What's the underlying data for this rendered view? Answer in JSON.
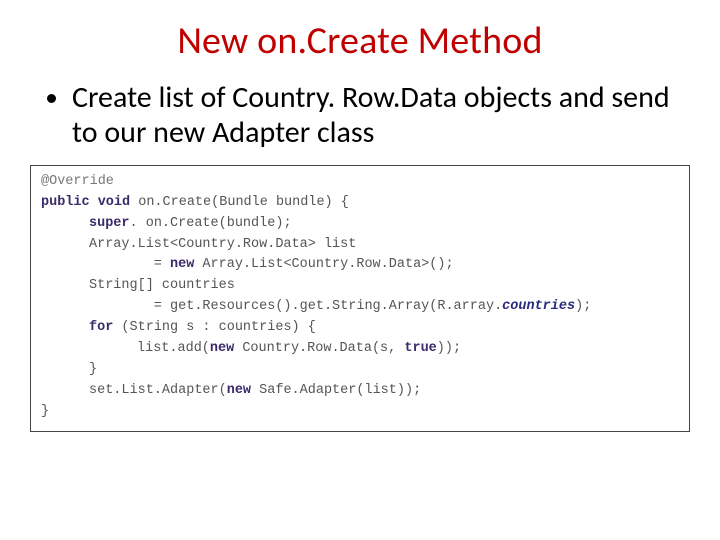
{
  "slide": {
    "title": "New on.Create Method",
    "bullets": [
      "Create list of Country. Row.Data objects and send to our new Adapter class"
    ]
  },
  "code": {
    "l01_ann": "@Override",
    "l02_kw1": "public void",
    "l02_rest": " on.Create(Bundle bundle) {",
    "l03_kw": "super",
    "l03_rest": ". on.Create(bundle);",
    "l04": "Array.List<Country.Row.Data> list",
    "l05_kw": "new",
    "l05_rest": " Array.List<Country.Row.Data>();",
    "l05_pre": "        = ",
    "l06": "String[] countries",
    "l07_pre": "        = get.Resources().get.String.Array(R.array.",
    "l07_em": "countries",
    "l07_post": ");",
    "l08_kw": "for",
    "l08_rest": " (String s : countries) {",
    "l09_pre": "list.add(",
    "l09_kw": "new",
    "l09_rest": " Country.Row.Data(s, ",
    "l09_kw2": "true",
    "l09_post": "));",
    "l10": "}",
    "l11_pre": "set.List.Adapter(",
    "l11_kw": "new",
    "l11_rest": " Safe.Adapter(list));",
    "l12": "}"
  }
}
